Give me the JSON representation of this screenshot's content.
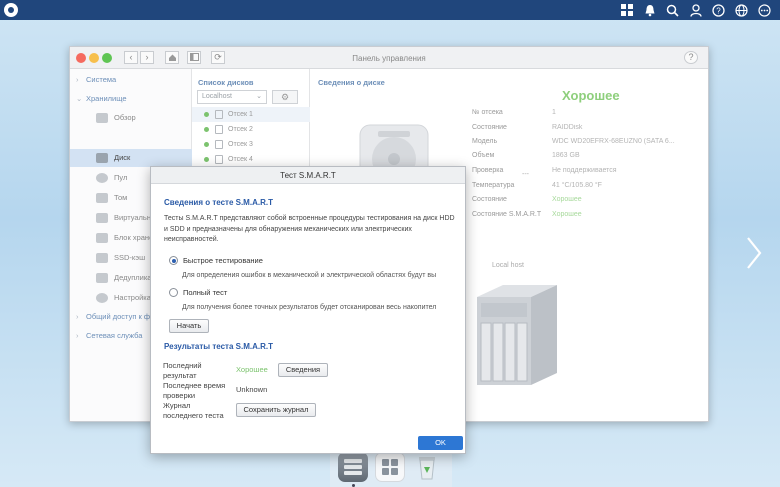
{
  "topbar": {
    "icons": [
      "apps-grid-icon",
      "bell-icon",
      "search-icon",
      "user-icon",
      "help-icon",
      "globe-icon",
      "more-icon"
    ]
  },
  "control_panel": {
    "title": "Панель управления",
    "sidebar": {
      "groups": [
        {
          "label": "Система"
        },
        {
          "label": "Хранилище"
        },
        {
          "label": "Общий доступ к ф"
        },
        {
          "label": "Сетевая служба"
        }
      ],
      "items": [
        {
          "label": "Обзор"
        },
        {
          "label": "Диск",
          "selected": true
        },
        {
          "label": "Пул"
        },
        {
          "label": "Том"
        },
        {
          "label": "Виртуальн"
        },
        {
          "label": "Блок хране"
        },
        {
          "label": "SSD-кэш"
        },
        {
          "label": "Дедуплика"
        },
        {
          "label": "Настройка"
        }
      ]
    },
    "disk_list": {
      "heading": "Список дисков",
      "host_select": "Localhost",
      "disks": [
        {
          "label": "Отсек 1"
        },
        {
          "label": "Отсек 2"
        },
        {
          "label": "Отсек 3"
        },
        {
          "label": "Отсек 4"
        }
      ]
    },
    "disk_info": {
      "heading": "Сведения о диске",
      "overall_status": "Хорошее",
      "rows": [
        {
          "key": "№ отсека",
          "value": "1"
        },
        {
          "key": "Состояние",
          "value": "RAIDDisk"
        },
        {
          "key": "Модель",
          "value": "WDC WD20EFRX-68EUZN0 (SATA 6..."
        },
        {
          "key": "Объем",
          "value": "1863 GB"
        },
        {
          "key": "Проверка",
          "value": "Не поддерживается"
        },
        {
          "key": "Температура",
          "value": "41 °C/105.80 °F"
        },
        {
          "key": "Состояние",
          "value": "Хорошее"
        },
        {
          "key": "Состояние S.M.A.R.T",
          "value": "Хорошее"
        }
      ],
      "enclosure_label": "Local host",
      "dash": "---"
    }
  },
  "dialog": {
    "title": "Тест S.M.A.R.T",
    "info_heading": "Сведения о тесте S.M.A.R.T",
    "description": "Тесты S.M.A.R.T представляют собой встроенные процедуры тестирования на диск HDD и SDD и предназначены для обнаружения механических или электрических неисправностей.",
    "quick_test": {
      "label": "Быстрое тестирование",
      "description": "Для определения ошибок в механической и электрической областях будут вы",
      "selected": true
    },
    "full_test": {
      "label": "Полный тест",
      "description": "Для получения более точных результатов будет отсканирован весь накопител",
      "selected": false
    },
    "start_button": "Начать",
    "results_heading": "Результаты теста S.M.A.R.T",
    "last_result_label": "Последний результат",
    "last_result_value": "Хорошее",
    "last_result_color": "#7cc36e",
    "details_button": "Сведения",
    "last_check_label": "Последнее время проверки",
    "last_check_value": "Unknown",
    "log_label": "Журнал последнего теста",
    "save_log_button": "Сохранить журнал",
    "ok_button": "OK"
  },
  "dock": {
    "icons": [
      "storage-manager-icon",
      "app-center-icon",
      "recycle-bin-icon"
    ]
  }
}
